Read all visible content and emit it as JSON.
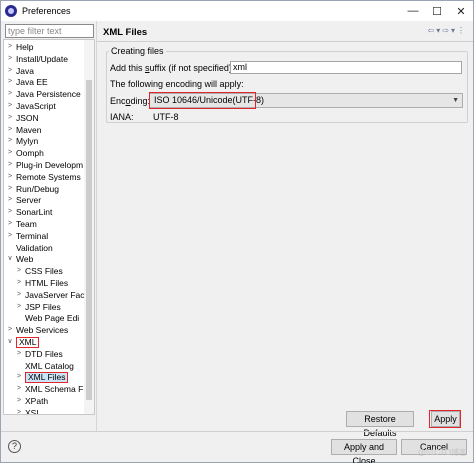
{
  "window": {
    "title": "Preferences",
    "controls": [
      "—",
      "☐",
      "✕"
    ]
  },
  "filter": {
    "placeholder": "type filter text"
  },
  "tree": {
    "items": [
      {
        "label": "Help",
        "twisty": ">",
        "indent": 0
      },
      {
        "label": "Install/Update",
        "twisty": ">",
        "indent": 0
      },
      {
        "label": "Java",
        "twisty": ">",
        "indent": 0
      },
      {
        "label": "Java EE",
        "twisty": ">",
        "indent": 0
      },
      {
        "label": "Java Persistence",
        "twisty": ">",
        "indent": 0
      },
      {
        "label": "JavaScript",
        "twisty": ">",
        "indent": 0
      },
      {
        "label": "JSON",
        "twisty": ">",
        "indent": 0
      },
      {
        "label": "Maven",
        "twisty": ">",
        "indent": 0
      },
      {
        "label": "Mylyn",
        "twisty": ">",
        "indent": 0
      },
      {
        "label": "Oomph",
        "twisty": ">",
        "indent": 0
      },
      {
        "label": "Plug-in Developm",
        "twisty": ">",
        "indent": 0
      },
      {
        "label": "Remote Systems",
        "twisty": ">",
        "indent": 0
      },
      {
        "label": "Run/Debug",
        "twisty": ">",
        "indent": 0
      },
      {
        "label": "Server",
        "twisty": ">",
        "indent": 0
      },
      {
        "label": "SonarLint",
        "twisty": ">",
        "indent": 0
      },
      {
        "label": "Team",
        "twisty": ">",
        "indent": 0
      },
      {
        "label": "Terminal",
        "twisty": ">",
        "indent": 0
      },
      {
        "label": "Validation",
        "twisty": "",
        "indent": 0
      },
      {
        "label": "Web",
        "twisty": "∨",
        "indent": 0
      },
      {
        "label": "CSS Files",
        "twisty": ">",
        "indent": 1
      },
      {
        "label": "HTML Files",
        "twisty": ">",
        "indent": 1
      },
      {
        "label": "JavaServer Fac",
        "twisty": ">",
        "indent": 1
      },
      {
        "label": "JSP Files",
        "twisty": ">",
        "indent": 1
      },
      {
        "label": "Web Page Edi",
        "twisty": "",
        "indent": 1
      },
      {
        "label": "Web Services",
        "twisty": ">",
        "indent": 0
      },
      {
        "label": "XML",
        "twisty": "∨",
        "indent": 0
      },
      {
        "label": "DTD Files",
        "twisty": ">",
        "indent": 1
      },
      {
        "label": "XML Catalog",
        "twisty": "",
        "indent": 1
      },
      {
        "label": "XML Files",
        "twisty": ">",
        "indent": 1
      },
      {
        "label": "XML Schema F",
        "twisty": ">",
        "indent": 1
      },
      {
        "label": "XPath",
        "twisty": ">",
        "indent": 1
      },
      {
        "label": "XSL",
        "twisty": ">",
        "indent": 1
      }
    ]
  },
  "page": {
    "title": "XML Files",
    "nav": [
      "⇦",
      "▾",
      "⇨",
      "▾",
      "⋮"
    ],
    "group_label": "Creating files",
    "suffix_label_pre": "Add this ",
    "suffix_label_mn": "s",
    "suffix_label_post": "uffix (if not specified):",
    "suffix_value": "xml",
    "encoding_info": "The following encoding will apply:",
    "encoding_label_pre": "Enc",
    "encoding_label_mn": "o",
    "encoding_label_post": "ding:",
    "encoding_value": "ISO 10646/Unicode(UTF-8)",
    "iana_label": "IANA:",
    "iana_value": "UTF-8"
  },
  "buttons": {
    "restore_defaults": "Restore Defaults",
    "apply": "Apply",
    "apply_and_close": "Apply and Close",
    "cancel": "Cancel",
    "help": "?"
  },
  "watermark": "@51CTO博客"
}
